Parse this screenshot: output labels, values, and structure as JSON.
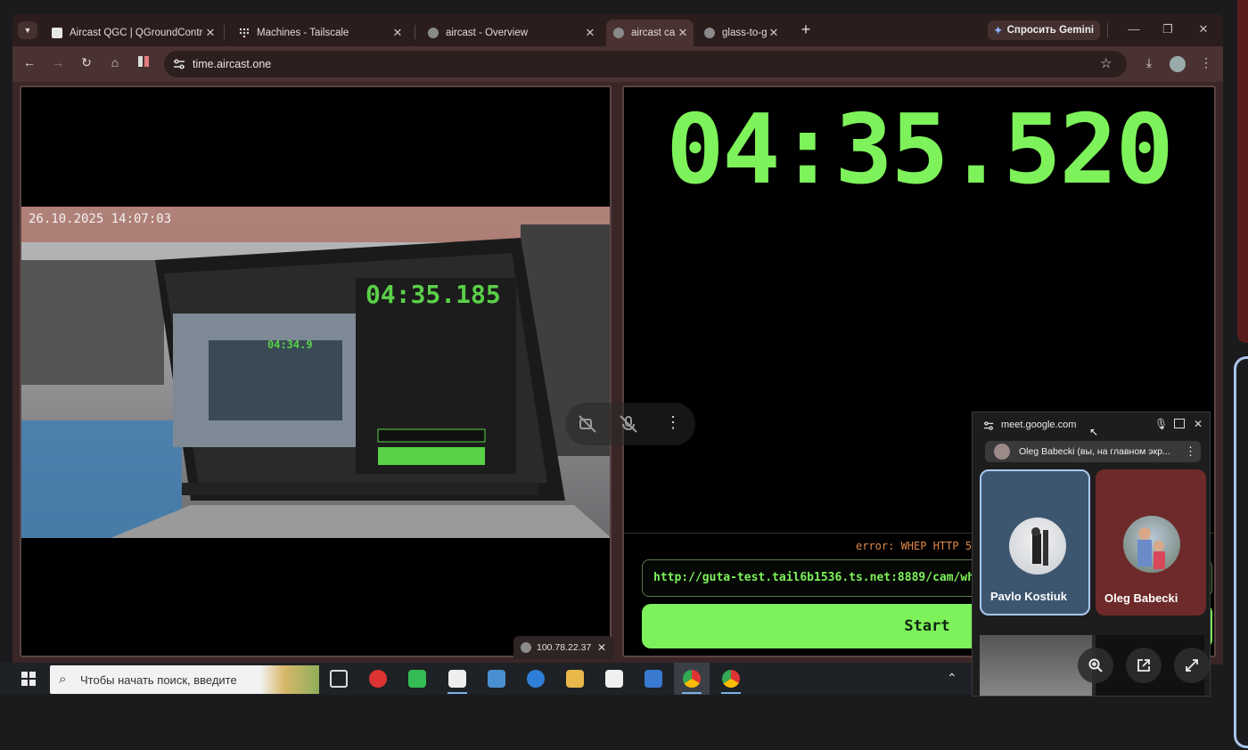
{
  "browser": {
    "tabs": [
      {
        "title": "Aircast QGC | QGroundControl",
        "close": "✕"
      },
      {
        "title": "Machines - Tailscale",
        "close": "✕"
      },
      {
        "title": "aircast - Overview",
        "close": "✕"
      },
      {
        "title": "aircast ca",
        "close": "✕"
      },
      {
        "title": "glass-to-g",
        "close": "✕"
      }
    ],
    "new_tab": "+",
    "gemini_label": "Спросить Gemini",
    "url": "time.aircast.one"
  },
  "camera": {
    "timestamp": "26.10.2025 14:07:03",
    "inner_timer": "04:35.185",
    "inner_timer_2": "04:34.9"
  },
  "timer": {
    "value": "04:35.520",
    "error": "error: WHEP HTTP 50",
    "stream_url": "http://guta-test.tail6b1536.ts.net:8889/cam/whep",
    "start_label": "Start"
  },
  "sharing_pill": {
    "ip": "100.78.22.37",
    "close": "✕"
  },
  "taskbar": {
    "search_placeholder": "Чтобы начать поиск, введите"
  },
  "meet": {
    "url": "meet.google.com",
    "strip_label": "Oleg Babecki (вы, на главном экр...",
    "participants": [
      {
        "name": "Pavlo Kostiuk"
      },
      {
        "name": "Oleg Babecki"
      }
    ]
  },
  "colors": {
    "accent_green": "#7ef25a",
    "browser_frame": "#3a2626"
  }
}
